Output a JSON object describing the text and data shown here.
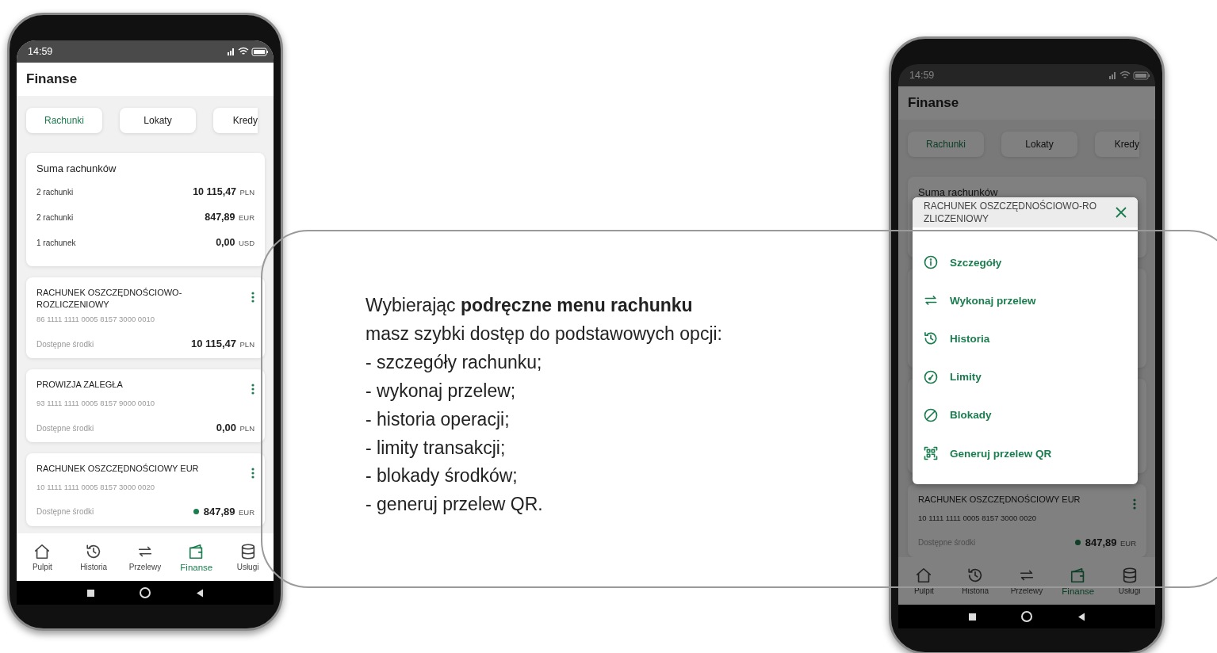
{
  "phones": [
    {
      "status_time": "14:59",
      "title": "Finanse",
      "dimmed": false,
      "tabs": [
        {
          "label": "Rachunki",
          "selected": true
        },
        {
          "label": "Lokaty",
          "selected": false
        },
        {
          "label": "Kredy",
          "selected": false
        }
      ],
      "summary": {
        "title": "Suma rachunków",
        "rows": [
          {
            "label": "2 rachunki",
            "amount": "10 115,47",
            "currency": "PLN"
          },
          {
            "label": "2 rachunki",
            "amount": "847,89",
            "currency": "EUR"
          },
          {
            "label": "1 rachunek",
            "amount": "0,00",
            "currency": "USD"
          }
        ]
      },
      "accounts": [
        {
          "name": "RACHUNEK OSZCZĘDNOŚCIOWO-ROZLICZENIOWY",
          "number": "86 1111 1111 0005 8157 3000 0010",
          "available_label": "Dostępne środki",
          "amount": "10 115,47",
          "currency": "PLN",
          "indicator": false
        },
        {
          "name": "PROWIZJA ZALEGŁA",
          "number": "93 1111 1111 0005 8157 9000 0010",
          "available_label": "Dostępne środki",
          "amount": "0,00",
          "currency": "PLN",
          "indicator": false
        },
        {
          "name": "RACHUNEK OSZCZĘDNOŚCIOWY EUR",
          "number": "10 1111 1111 0005 8157 3000 0020",
          "available_label": "Dostępne środki",
          "amount": "847,89",
          "currency": "EUR",
          "indicator": true
        }
      ],
      "nav": [
        {
          "label": "Pulpit",
          "selected": false
        },
        {
          "label": "Historia",
          "selected": false
        },
        {
          "label": "Przelewy",
          "selected": false
        },
        {
          "label": "Finanse",
          "selected": true
        },
        {
          "label": "Usługi",
          "selected": false
        }
      ]
    },
    {
      "status_time": "14:59",
      "title": "Finanse",
      "dimmed": true,
      "tabs": [
        {
          "label": "Rachunki",
          "selected": true
        },
        {
          "label": "Lokaty",
          "selected": false
        },
        {
          "label": "Kredy",
          "selected": false
        }
      ],
      "summary": {
        "title": "Suma rachunków"
      },
      "accounts": [
        {
          "name": "RACHUNEK OSZCZĘDNOŚCIOWY EUR",
          "number": "10 1111 1111 0005 8157 3000 0020",
          "available_label": "Dostępne środki",
          "amount": "847,89",
          "currency": "EUR",
          "indicator": true
        }
      ],
      "nav": [
        {
          "label": "Pulpit",
          "selected": false
        },
        {
          "label": "Historia",
          "selected": false
        },
        {
          "label": "Przelewy",
          "selected": false
        },
        {
          "label": "Finanse",
          "selected": true
        },
        {
          "label": "Usługi",
          "selected": false
        }
      ],
      "menu": {
        "title": "RACHUNEK OSZCZĘDNOŚCIOWO-RO\nZLICZENIOWY",
        "items": [
          {
            "label": "Szczegóły"
          },
          {
            "label": "Wykonaj przelew"
          },
          {
            "label": "Historia"
          },
          {
            "label": "Limity"
          },
          {
            "label": "Blokady"
          },
          {
            "label": "Generuj przelew QR"
          }
        ]
      }
    }
  ],
  "description": [
    "Wybierając **podręczne menu rachunku**",
    "masz szybki dostęp do podstawowych opcji:",
    "- szczegóły rachunku;",
    "- wykonaj przelew;",
    "- historia operacji;",
    "- limity transakcji;",
    "- blokady środków;",
    "- generuj przelew QR."
  ]
}
